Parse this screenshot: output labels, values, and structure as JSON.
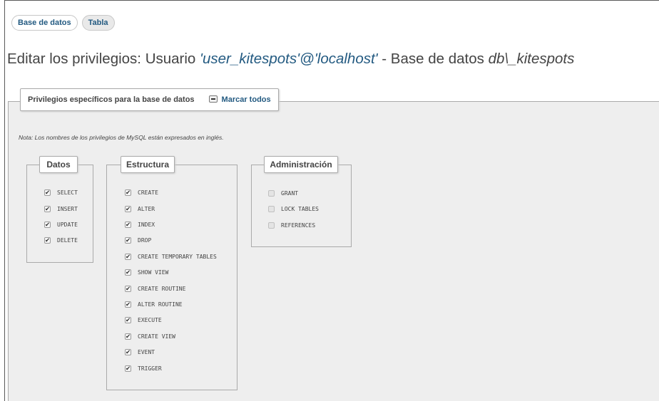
{
  "tabs": [
    {
      "label": "Base de datos"
    },
    {
      "label": "Tabla"
    }
  ],
  "title": {
    "prefix": "Editar los privilegios: Usuario ",
    "user": "'user_kitespots'@'localhost'",
    "middle": " - Base de datos ",
    "database": "db\\_kitespots"
  },
  "fieldset": {
    "legend": "Privilegios específicos para la base de datos",
    "check_all_label": "Marcar todos",
    "note": "Nota: Los nombres de los privilegios de MySQL están expresados en inglés."
  },
  "groups": {
    "datos": {
      "legend": "Datos",
      "items": [
        {
          "label": "SELECT",
          "checked": true
        },
        {
          "label": "INSERT",
          "checked": true
        },
        {
          "label": "UPDATE",
          "checked": true
        },
        {
          "label": "DELETE",
          "checked": true
        }
      ]
    },
    "estructura": {
      "legend": "Estructura",
      "items": [
        {
          "label": "CREATE",
          "checked": true
        },
        {
          "label": "ALTER",
          "checked": true
        },
        {
          "label": "INDEX",
          "checked": true
        },
        {
          "label": "DROP",
          "checked": true
        },
        {
          "label": "CREATE TEMPORARY TABLES",
          "checked": true
        },
        {
          "label": "SHOW VIEW",
          "checked": true
        },
        {
          "label": "CREATE ROUTINE",
          "checked": true
        },
        {
          "label": "ALTER ROUTINE",
          "checked": true
        },
        {
          "label": "EXECUTE",
          "checked": true
        },
        {
          "label": "CREATE VIEW",
          "checked": true
        },
        {
          "label": "EVENT",
          "checked": true
        },
        {
          "label": "TRIGGER",
          "checked": true
        }
      ]
    },
    "administracion": {
      "legend": "Administración",
      "items": [
        {
          "label": "GRANT",
          "checked": false
        },
        {
          "label": "LOCK TABLES",
          "checked": false
        },
        {
          "label": "REFERENCES",
          "checked": false
        }
      ]
    }
  },
  "colors": {
    "link": "#235a81",
    "panel": "#eeeeee",
    "border": "#aaaaaa"
  }
}
